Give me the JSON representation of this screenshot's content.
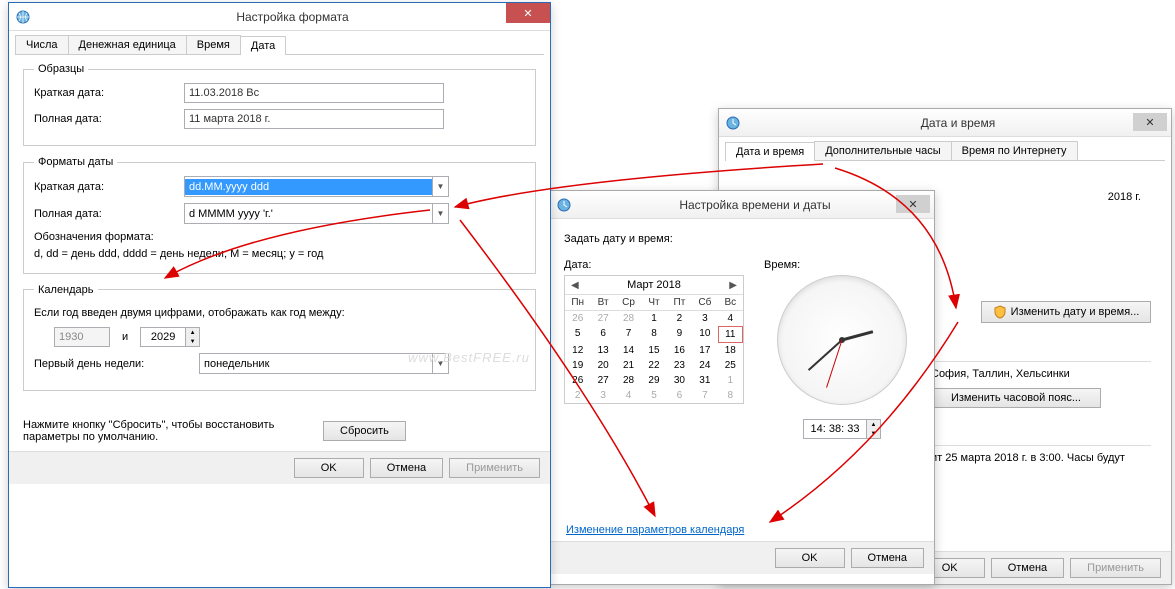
{
  "w3": {
    "title": "Настройка формата",
    "tabs": [
      "Числа",
      "Денежная единица",
      "Время",
      "Дата"
    ],
    "samples_legend": "Образцы",
    "short_date_label": "Краткая дата:",
    "short_date_value": "11.03.2018 Вс",
    "long_date_label": "Полная дата:",
    "long_date_value": "11 марта 2018 г.",
    "formats_legend": "Форматы даты",
    "short_fmt_label": "Краткая дата:",
    "short_fmt_value": "dd.MM.yyyy ddd",
    "long_fmt_label": "Полная дата:",
    "long_fmt_value": "d MMMM yyyy 'г.'",
    "notation_label": "Обозначения формата:",
    "notation_text": "d, dd = день  ddd, dddd = день недели; M = месяц; y = год",
    "calendar_legend": "Календарь",
    "calendar_between": "Если год введен двумя цифрами, отображать как год между:",
    "year_from": "1930",
    "year_connector": "и",
    "year_to": "2029",
    "first_day_label": "Первый день недели:",
    "first_day_value": "понедельник",
    "reset_hint": "Нажмите кнопку \"Сбросить\", чтобы восстановить параметры по умолчанию.",
    "reset_btn": "Сбросить",
    "ok": "OK",
    "cancel": "Отмена",
    "apply": "Применить"
  },
  "w1": {
    "title": "Дата и время",
    "tabs": [
      "Дата и время",
      "Дополнительные часы",
      "Время по Интернету"
    ],
    "year_text": "2018 г.",
    "change_dt_btn": "Изменить дату и время...",
    "tz_cities": "София, Таллин, Хельсинки",
    "change_tz_btn": "Изменить часовой пояс...",
    "dst_text": "ит 25 марта 2018 г. в 3:00. Часы будут",
    "ok": "OK",
    "cancel": "Отмена",
    "apply": "Применить"
  },
  "w2": {
    "title": "Настройка времени и даты",
    "set_label": "Задать дату и время:",
    "date_label": "Дата:",
    "time_label": "Время:",
    "cal_month": "Март 2018",
    "cal_days": [
      "Пн",
      "Вт",
      "Ср",
      "Чт",
      "Пт",
      "Сб",
      "Вс"
    ],
    "cal_cells": [
      {
        "d": "26",
        "o": true
      },
      {
        "d": "27",
        "o": true
      },
      {
        "d": "28",
        "o": true
      },
      {
        "d": "1"
      },
      {
        "d": "2"
      },
      {
        "d": "3"
      },
      {
        "d": "4"
      },
      {
        "d": "5"
      },
      {
        "d": "6"
      },
      {
        "d": "7"
      },
      {
        "d": "8"
      },
      {
        "d": "9"
      },
      {
        "d": "10"
      },
      {
        "d": "11",
        "t": true
      },
      {
        "d": "12"
      },
      {
        "d": "13"
      },
      {
        "d": "14"
      },
      {
        "d": "15"
      },
      {
        "d": "16"
      },
      {
        "d": "17"
      },
      {
        "d": "18"
      },
      {
        "d": "19"
      },
      {
        "d": "20"
      },
      {
        "d": "21"
      },
      {
        "d": "22"
      },
      {
        "d": "23"
      },
      {
        "d": "24"
      },
      {
        "d": "25"
      },
      {
        "d": "26"
      },
      {
        "d": "27"
      },
      {
        "d": "28"
      },
      {
        "d": "29"
      },
      {
        "d": "30"
      },
      {
        "d": "31"
      },
      {
        "d": "1",
        "o": true
      },
      {
        "d": "2",
        "o": true
      },
      {
        "d": "3",
        "o": true
      },
      {
        "d": "4",
        "o": true
      },
      {
        "d": "5",
        "o": true
      },
      {
        "d": "6",
        "o": true
      },
      {
        "d": "7",
        "o": true
      },
      {
        "d": "8",
        "o": true
      }
    ],
    "time_value": "14: 38: 33",
    "cal_link": "Изменение параметров календаря",
    "ok": "OK",
    "cancel": "Отмена"
  },
  "watermark": "www.BestFREE.ru"
}
